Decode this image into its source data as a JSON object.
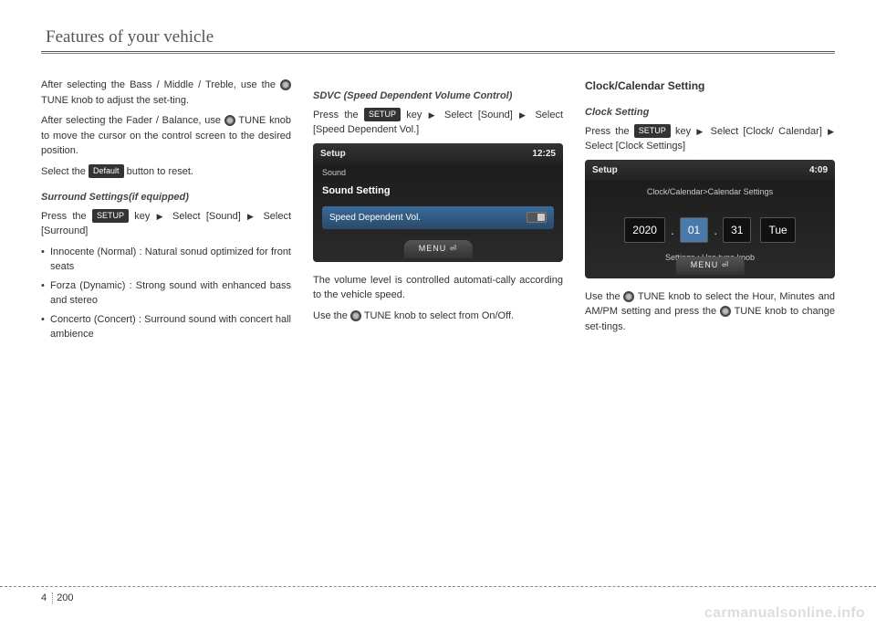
{
  "header": "Features of your vehicle",
  "col1": {
    "p1a": "After selecting the Bass / Middle / Treble, use the ",
    "p1b": " TUNE knob to adjust the set-ting.",
    "p2a": "After selecting the Fader / Balance, use ",
    "p2b": " TUNE knob to move the cursor on the control screen to the desired position.",
    "p3a": "Select the ",
    "defaultBtn": "Default",
    "p3b": " button to reset.",
    "surroundHeading": "Surround Settings(if equipped)",
    "p4a": "Press the ",
    "setupBtn": "SETUP",
    "p4b": " key",
    "p4c": " Select [Sound] ",
    "p4d": " Select [Surround]",
    "li1": "Innocente (Normal) : Natural sonud optimized for front seats",
    "li2": "Forza (Dynamic) : Strong sound  with enhanced bass and stereo",
    "li3": "Concerto (Concert) : Surround sound with concert hall ambience"
  },
  "col2": {
    "sdvcHeading": "SDVC (Speed Dependent Volume Control)",
    "p1a": "Press the ",
    "setupBtn": "SETUP",
    "p1b": " key",
    "p1c": " Select [Sound] ",
    "p1d": " Select [Speed Dependent Vol.]",
    "screen": {
      "title": "Setup",
      "time": "12:25",
      "sub1": "Sound",
      "sub2": "Sound Setting",
      "row": "Speed Dependent Vol.",
      "menu": "MENU ⏎"
    },
    "p2": "The volume level is controlled automati-cally according to the vehicle speed.",
    "p3a": "Use  the ",
    "p3b": " TUNE knob to select from On/Off."
  },
  "col3": {
    "mainHeading": "Clock/Calendar Setting",
    "clockHeading": "Clock Setting",
    "p1a": "Press the ",
    "setupBtn": "SETUP",
    "p1b": " key",
    "p1c": " Select [Clock/ Calendar]",
    "p1d": " Select [Clock Settings]",
    "screen": {
      "title": "Setup",
      "time": "4:09",
      "crumb": "Clock/Calendar>Calendar Settings",
      "year": "2020",
      "month": "01",
      "day": "31",
      "dow": "Tue",
      "note": "Settings : Use tune knob",
      "menu": "MENU ⏎"
    },
    "p2a": "Use  the ",
    "p2b": " TUNE knob to select the Hour, Minutes and AM/PM setting and press the ",
    "p2c": " TUNE knob to change set-tings."
  },
  "page": {
    "chapter": "4",
    "num": "200"
  },
  "watermark": "carmanualsonline.info"
}
